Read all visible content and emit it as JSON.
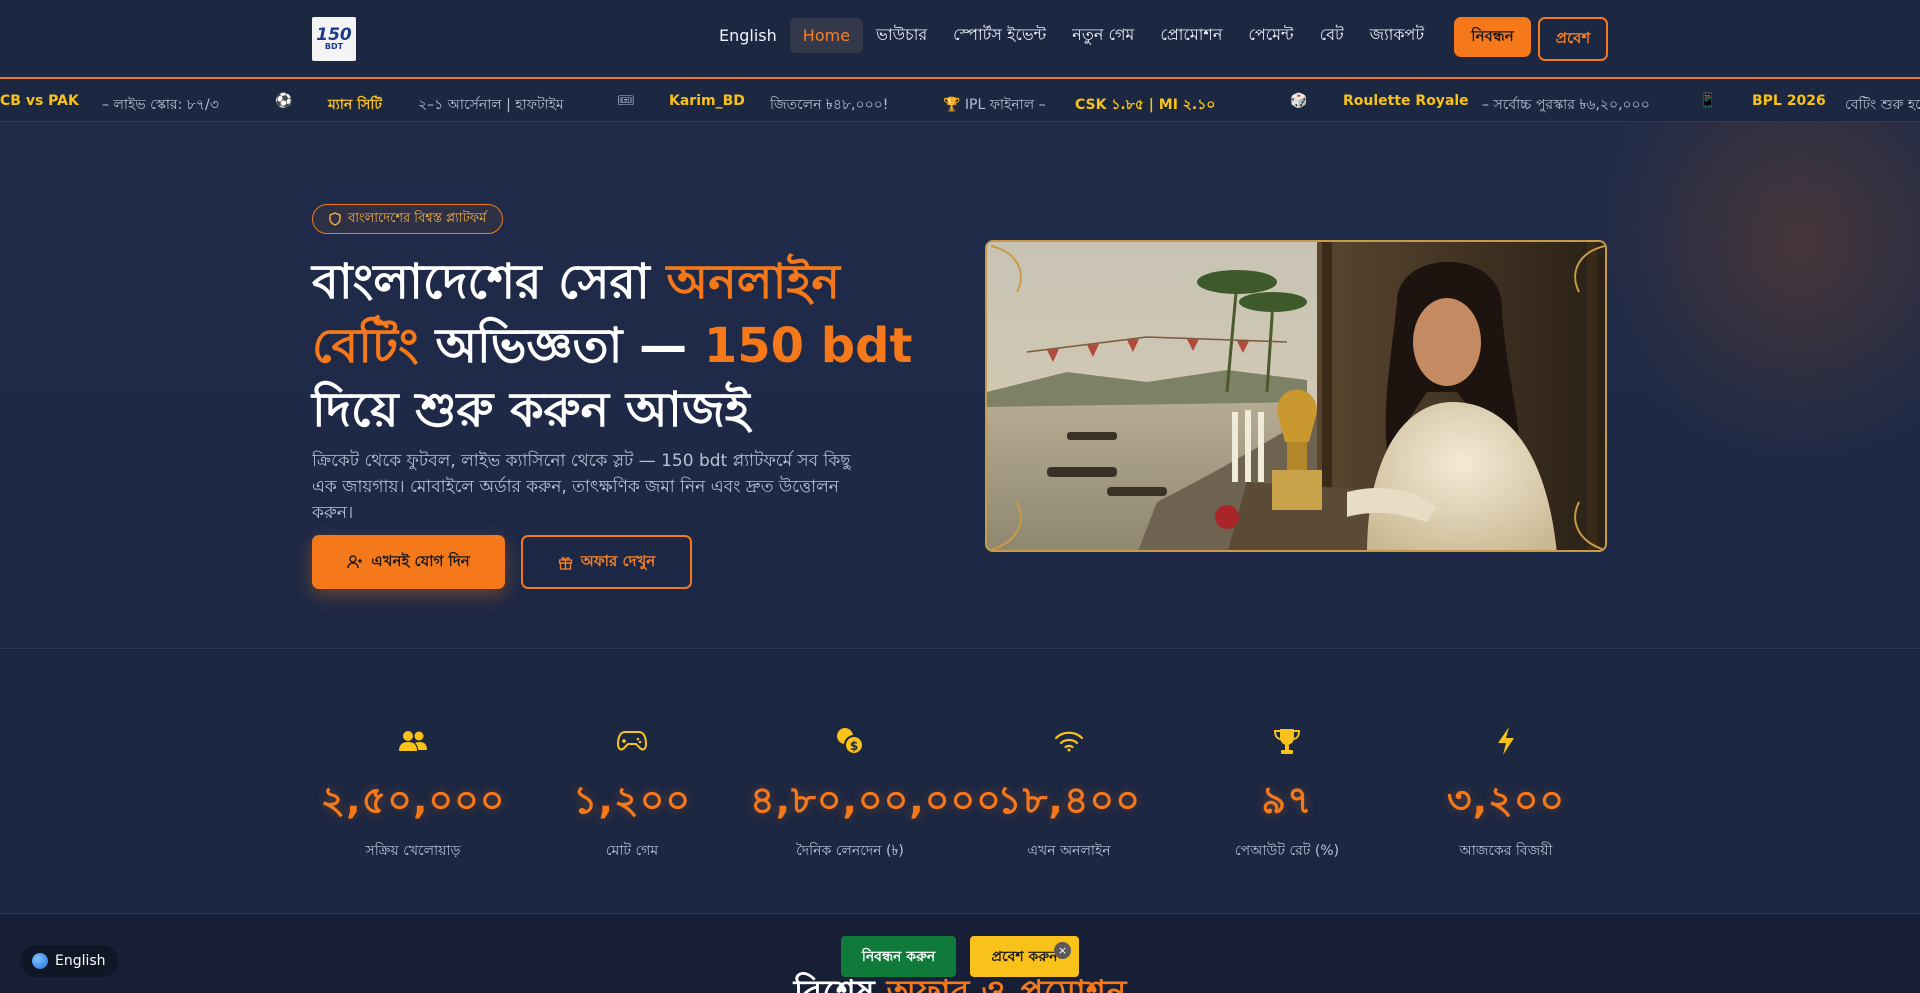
{
  "header": {
    "logo_text": "150",
    "logo_sub": "BDT",
    "nav": [
      {
        "label": "English"
      },
      {
        "label": "Home",
        "active": true
      },
      {
        "label": "ভাউচার"
      },
      {
        "label": "স্পোর্টস ইভেন্ট"
      },
      {
        "label": "নতুন গেম"
      },
      {
        "label": "প্রোমোশন"
      },
      {
        "label": "পেমেন্ট"
      },
      {
        "label": "বেট"
      },
      {
        "label": "জ্যাকপট"
      }
    ],
    "register_label": "নিবন্ধন",
    "login_label": "প্রবেশ"
  },
  "ticker": {
    "items": [
      {
        "text": "CB vs PAK",
        "style": "hl"
      },
      {
        "text": "– লাইভ স্কোর: ৮৭/৩",
        "style": "tx"
      },
      {
        "text": "⚽",
        "style": "tx"
      },
      {
        "text": "ম্যান সিটি",
        "style": "hl"
      },
      {
        "text": "২–১ আর্সেনাল | হাফটাইম",
        "style": "tx"
      },
      {
        "text": "🎟",
        "style": "tx"
      },
      {
        "text": "Karim_BD",
        "style": "hl"
      },
      {
        "text": "জিতলেন ৳৪৮,০০০!",
        "style": "tx"
      },
      {
        "text": "🏆 IPL ফাইনাল –",
        "style": "tx"
      },
      {
        "text": "CSK ১.৮৫ | MI ২.১০",
        "style": "hl"
      },
      {
        "text": "🎲",
        "style": "tx"
      },
      {
        "text": "Roulette Royale",
        "style": "hl"
      },
      {
        "text": "– সর্বোচ্চ পুরস্কার ৳৬,২০,০০০",
        "style": "tx"
      },
      {
        "text": "📱",
        "style": "tx"
      },
      {
        "text": "BPL 2026",
        "style": "hl"
      },
      {
        "text": "বেটিং শুরু হচ্ছে",
        "style": "tx"
      }
    ]
  },
  "hero": {
    "badge": "বাংলাদেশের বিশ্বস্ত প্ল্যাটফর্ম",
    "title_part1": "বাংলাদেশের সেরা ",
    "title_part2": "অনলাইন বেটিং",
    "title_part3": " অভিজ্ঞতা — ",
    "title_part4": "150 bdt",
    "title_part5": " দিয়ে শুরু করুন আজই",
    "description": "ক্রিকেট থেকে ফুটবল, লাইভ ক্যাসিনো থেকে স্লট — 150 bdt প্ল্যাটফর্মে সব কিছু এক জায়গায়। মোবাইলে অর্ডার করুন, তাৎক্ষণিক জমা নিন এবং দ্রুত উত্তোলন করুন।",
    "join_label": "এখনই যোগ দিন",
    "offer_label": "অফার দেখুন"
  },
  "stats": [
    {
      "icon": "users-icon",
      "value": "২,৫০,০০০",
      "label": "সক্রিয় খেলোয়াড়"
    },
    {
      "icon": "gamepad-icon",
      "value": "১,২০০",
      "label": "মোট গেম"
    },
    {
      "icon": "coins-icon",
      "value": "৪,৮০,০০,০০০",
      "label": "দৈনিক লেনদেন (৳)"
    },
    {
      "icon": "wifi-icon",
      "value": "১৮,৪০০",
      "label": "এখন অনলাইন"
    },
    {
      "icon": "trophy-icon",
      "value": "৯৭",
      "label": "পেআউট রেট (%)"
    },
    {
      "icon": "bolt-icon",
      "value": "৩,২০০",
      "label": "আজকের বিজয়ী"
    }
  ],
  "bottom": {
    "language": "English",
    "section_title_part1": "বিশেষ ",
    "section_title_part2": "অফার ও প্রমোশন",
    "cta_register": "নিবন্ধন করুন",
    "cta_login": "প্রবেশ করুন",
    "close_symbol": "×"
  },
  "colors": {
    "accent": "#f5781a",
    "highlight": "#f8c21a",
    "background": "#1c2742",
    "cta_green": "#0f7a3a"
  }
}
